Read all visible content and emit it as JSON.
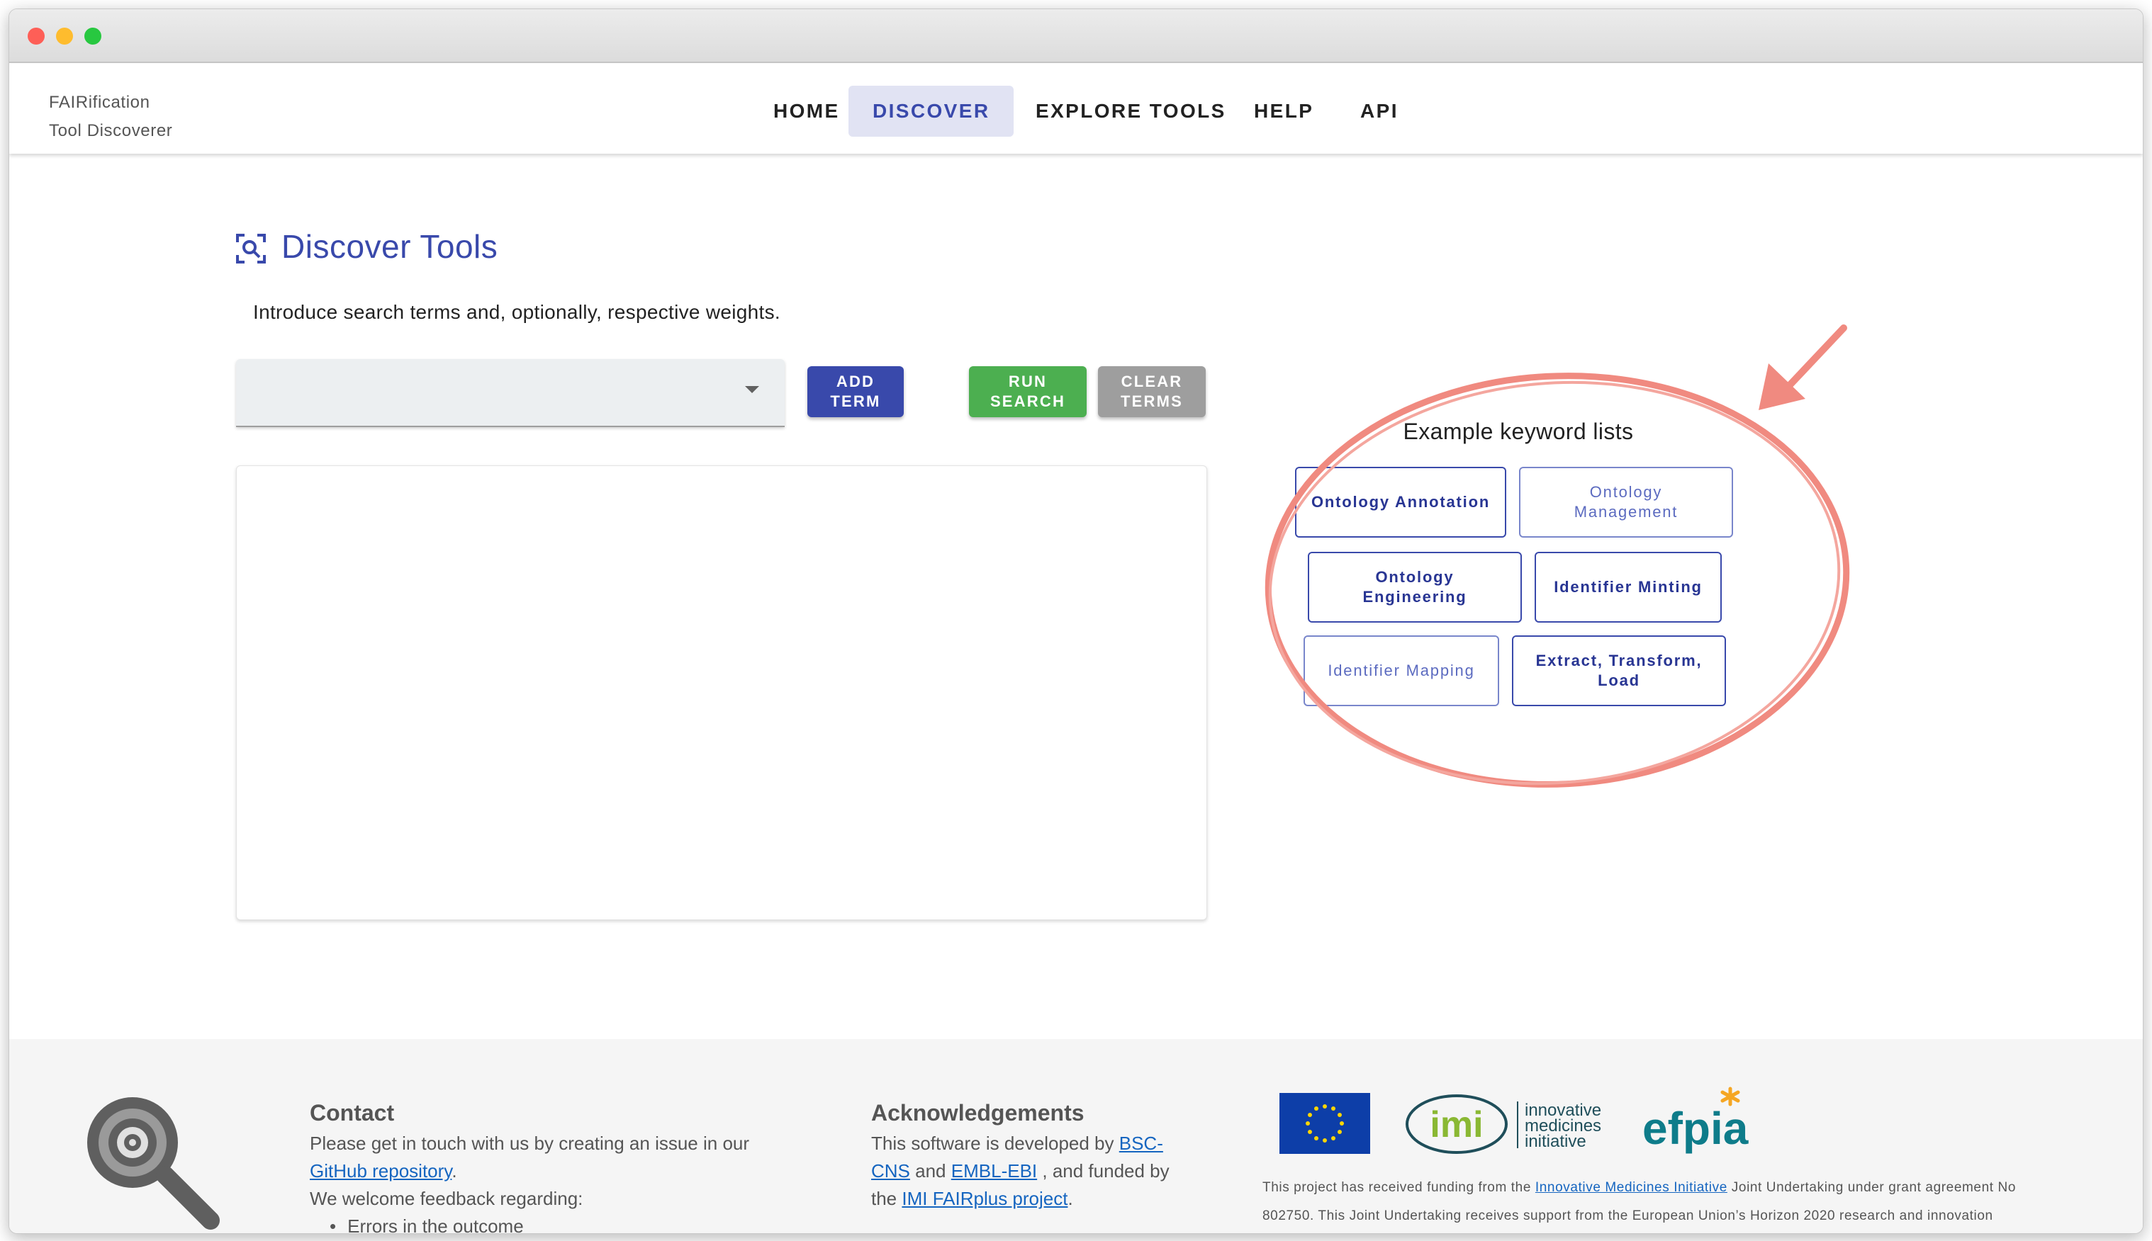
{
  "header": {
    "brand_line1": "FAIRification",
    "brand_line2": "Tool Discoverer",
    "nav": [
      "HOME",
      "DISCOVER",
      "EXPLORE TOOLS",
      "HELP",
      "API"
    ],
    "active_nav": "DISCOVER"
  },
  "main": {
    "title": "Discover Tools",
    "subtitle": "Introduce search terms and, optionally, respective weights.",
    "select_value": "",
    "buttons": {
      "add_line1": "ADD",
      "add_line2": "TERM",
      "run_line1": "RUN",
      "run_line2": "SEARCH",
      "clear_line1": "CLEAR",
      "clear_line2": "TERMS"
    }
  },
  "examples": {
    "title": "Example keyword lists",
    "items": [
      {
        "line1": "Ontology Annotation",
        "line2": ""
      },
      {
        "line1": "Ontology",
        "line2": "Management"
      },
      {
        "line1": "Ontology",
        "line2": "Engineering"
      },
      {
        "line1": "Identifier Minting",
        "line2": ""
      },
      {
        "line1": "Identifier Mapping",
        "line2": ""
      },
      {
        "line1": "Extract, Transform,",
        "line2": "Load"
      }
    ]
  },
  "footer": {
    "contact": {
      "heading": "Contact",
      "line1_pre": "Please get in touch with us by creating an issue in our",
      "link": "GitHub repository",
      "line2_post": ".",
      "line3": "We welcome feedback regarding:",
      "bullet1": "Errors in the outcome"
    },
    "ack": {
      "heading": "Acknowledgements",
      "line1_pre": "This software is developed by",
      "link_bsc_1": "BSC-",
      "link_bsc_2": "CNS",
      "and1": "and",
      "link_embl": "EMBL-EBI",
      "funded": ", and funded by",
      "the": "the",
      "link_imi": "IMI FAIRplus project",
      "dot": "."
    },
    "logos": {
      "imi_line1": "innovative",
      "imi_line2": "medicines",
      "imi_line3": "initiative",
      "imi_mark": "imi",
      "efpia": "efpia"
    },
    "funding_pre": "This project has received funding from the",
    "funding_link": "Innovative Medicines Initiative",
    "funding_post": "Joint Undertaking under grant agreement No",
    "funding_line2": "802750. This Joint Undertaking receives support from the European Union’s Horizon 2020 research and innovation"
  },
  "colors": {
    "primary": "#3949ab",
    "run": "#4caf50",
    "clear": "#9e9e9e",
    "annotation": "#f08a80"
  }
}
